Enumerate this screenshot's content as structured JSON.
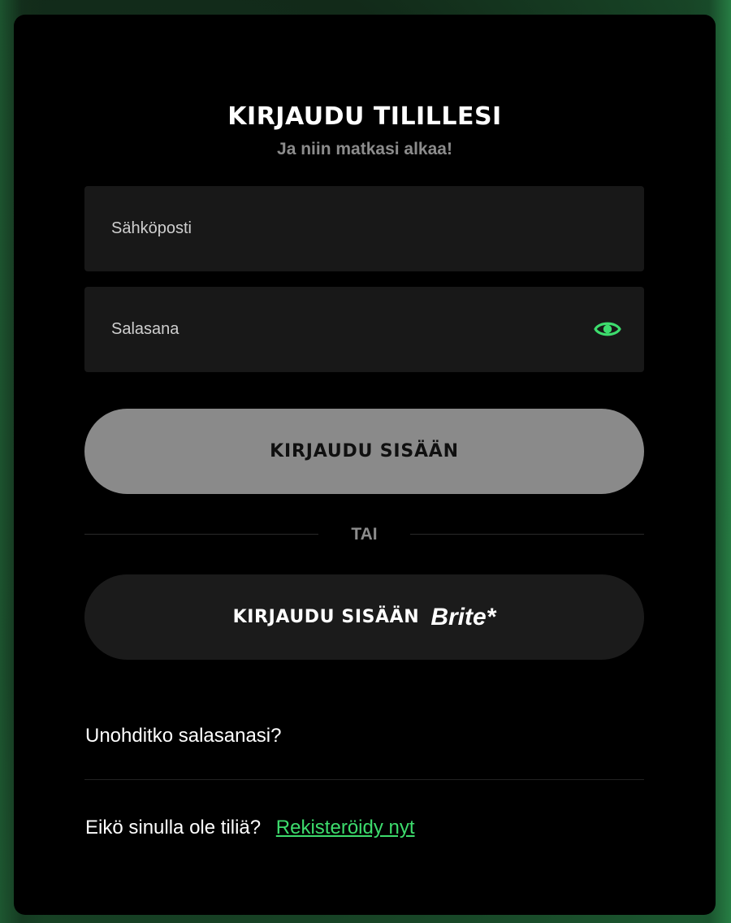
{
  "login": {
    "title": "KIRJAUDU TILILLESI",
    "subtitle": "Ja niin matkasi alkaa!",
    "email_label": "Sähköposti",
    "password_label": "Salasana",
    "show_password_icon": "eye-icon",
    "submit_label": "KIRJAUDU SISÄÄN",
    "divider_text": "TAI",
    "brite_button_label": "KIRJAUDU SISÄÄN",
    "brite_logo": "Brite*",
    "forgot_password": "Unohditko salasanasi?",
    "no_account_text": "Eikö sinulla ole tiliä?",
    "register_link": "Rekisteröidy nyt"
  },
  "colors": {
    "accent": "#3ddc6d",
    "card_bg": "#000000",
    "field_bg": "#181818",
    "submit_bg": "#8a8a8a",
    "brite_bg": "#1b1b1b"
  }
}
